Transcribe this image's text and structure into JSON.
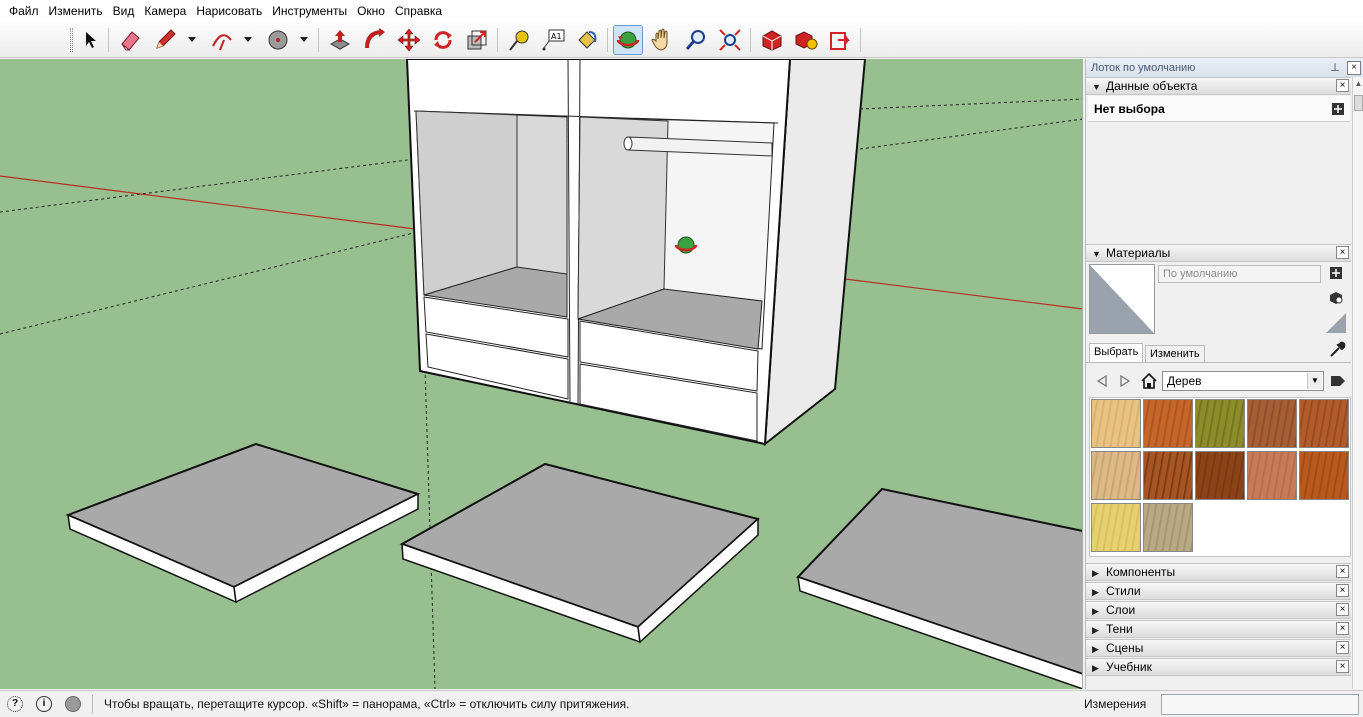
{
  "menu": [
    {
      "label": "Файл",
      "name": "menu-file"
    },
    {
      "label": "Изменить",
      "name": "menu-edit"
    },
    {
      "label": "Вид",
      "name": "menu-view"
    },
    {
      "label": "Камера",
      "name": "menu-camera"
    },
    {
      "label": "Нарисовать",
      "name": "menu-draw"
    },
    {
      "label": "Инструменты",
      "name": "menu-tools"
    },
    {
      "label": "Окно",
      "name": "menu-window"
    },
    {
      "label": "Справка",
      "name": "menu-help"
    }
  ],
  "toolbar": {
    "tools": [
      "select-icon",
      "eraser-icon",
      "pencil-icon",
      "arc-icon",
      "circle-shape-icon",
      "push-pull-icon",
      "follow-me-icon",
      "move-icon",
      "rotate-icon",
      "scale-icon",
      "tape-measure-icon",
      "text-label-icon",
      "paint-bucket-icon",
      "orbit-icon",
      "pan-icon",
      "zoom-icon",
      "zoom-extents-icon",
      "warehouse-icon",
      "components-icon",
      "send-layout-icon"
    ],
    "text_tool_label": "A1",
    "active_tool": "orbit-icon"
  },
  "tray": {
    "title": "Лоток по умолчанию",
    "pin": "⊥",
    "close": "×"
  },
  "entity_info": {
    "header": "Данные объекта",
    "content": "Нет выбора"
  },
  "materials": {
    "header": "Материалы",
    "name_value": "По умолчанию",
    "tabs": [
      "Выбрать",
      "Изменить"
    ],
    "library": "Дерев",
    "swatches": [
      {
        "color": "#e9c383",
        "accent": "#d8ac66"
      },
      {
        "color": "#c5662b",
        "accent": "#a84f1c"
      },
      {
        "color": "#8c8c2a",
        "accent": "#6f6e1e"
      },
      {
        "color": "#a55e35",
        "accent": "#8a4a26"
      },
      {
        "color": "#b25c2b",
        "accent": "#8f4520"
      },
      {
        "color": "#dcb988",
        "accent": "#c79d6c"
      },
      {
        "color": "#a85523",
        "accent": "#6e3511"
      },
      {
        "color": "#8c4218",
        "accent": "#74360f"
      },
      {
        "color": "#c87b58",
        "accent": "#b26a48"
      },
      {
        "color": "#b85a1d",
        "accent": "#9b4714"
      },
      {
        "color": "#e6d070",
        "accent": "#d4bc58"
      },
      {
        "color": "#b9a985",
        "accent": "#9f906d"
      }
    ]
  },
  "collapsed_panels": [
    "Компоненты",
    "Стили",
    "Слои",
    "Тени",
    "Сцены",
    "Учебник"
  ],
  "status": {
    "hint": "Чтобы вращать, перетащите курсор. «Shift» = панорама, «Ctrl» = отключить силу притяжения.",
    "measure_label": "Измерения",
    "measure_value": ""
  },
  "colors": {
    "ground": "#97bf8f",
    "axis_red": "#b83020",
    "panel_face": "#a9a9a9",
    "panel_edge": "#ffffff"
  }
}
